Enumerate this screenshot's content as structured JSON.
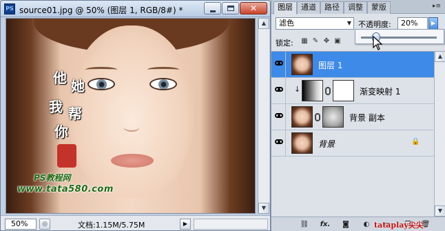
{
  "doc_window": {
    "app_icon": "PS",
    "title": "source01.jpg @ 50% (图层 1, RGB/8#) *",
    "window_buttons": {
      "minimize": "",
      "maximize": "",
      "close": "✕"
    },
    "watermark": {
      "chars": [
        "他",
        "她",
        "我",
        "帮",
        "你"
      ],
      "ps_text": "PS教程网",
      "url_text": "www.tata580.com"
    },
    "status_bar": {
      "zoom": "50%",
      "doc_info": "文档:1.15M/5.75M"
    }
  },
  "layers_panel": {
    "tabs": [
      {
        "label": "图层",
        "active": true
      },
      {
        "label": "通道",
        "active": false
      },
      {
        "label": "路径",
        "active": false
      },
      {
        "label": "调整",
        "active": false
      },
      {
        "label": "蒙版",
        "active": false
      }
    ],
    "blend_mode": "滤色",
    "opacity_label": "不透明度:",
    "opacity_value": "20%",
    "opacity_slider_fraction": 0.2,
    "lock_label": "锁定:",
    "lock_icons": [
      "lock-transparent-icon",
      "lock-paint-icon",
      "lock-move-icon",
      "lock-all-icon"
    ],
    "layers": [
      {
        "name": "图层 1",
        "visible": true,
        "selected": true,
        "thumb": "face",
        "mask": null,
        "italic": false,
        "locked": false,
        "clipped": false
      },
      {
        "name": "渐变映射 1",
        "visible": true,
        "selected": false,
        "thumb": "gradient",
        "mask": "white",
        "italic": false,
        "locked": false,
        "clipped": true
      },
      {
        "name": "背景 副本",
        "visible": true,
        "selected": false,
        "thumb": "face",
        "mask": "sketch",
        "italic": false,
        "locked": false,
        "clipped": false
      },
      {
        "name": "背景",
        "visible": true,
        "selected": false,
        "thumb": "face",
        "mask": null,
        "italic": true,
        "locked": true,
        "clipped": false
      }
    ],
    "footer_buttons": [
      "link-layers-icon",
      "fx-icon",
      "add-mask-icon",
      "adjustment-layer-icon",
      "new-group-icon",
      "new-layer-icon",
      "trash-icon"
    ],
    "footer_fx_label": "fx."
  },
  "brand_text": "tataplay尖尖"
}
